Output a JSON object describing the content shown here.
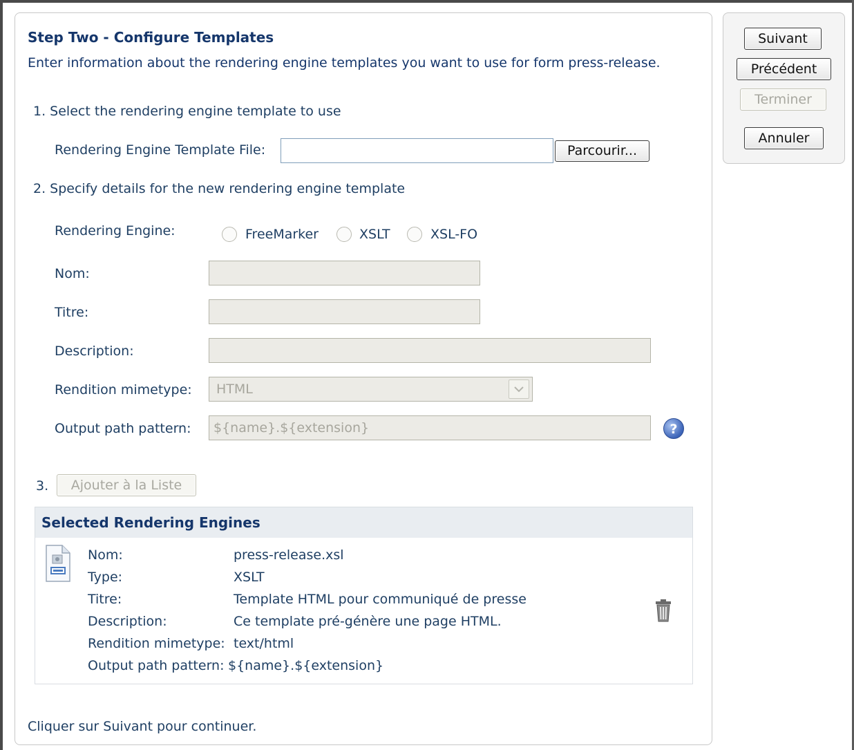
{
  "wizard": {
    "title": "Step Two - Configure Templates",
    "intro": "Enter information about the rendering engine templates you want to use for form press-release.",
    "footer": "Cliquer sur Suivant pour continuer."
  },
  "nav_buttons": {
    "next": "Suivant",
    "previous": "Précédent",
    "finish": "Terminer",
    "cancel": "Annuler"
  },
  "step1": {
    "heading": "1. Select the rendering engine template to use",
    "file_label": "Rendering Engine Template File:",
    "file_value": "",
    "browse_button": "Parcourir..."
  },
  "step2": {
    "heading": "2. Specify details for the new rendering engine template",
    "engine_label": "Rendering Engine:",
    "engines": [
      "FreeMarker",
      "XSLT",
      "XSL-FO"
    ],
    "name_label": "Nom:",
    "name_value": "",
    "title_label": "Titre:",
    "title_value": "",
    "description_label": "Description:",
    "description_value": "",
    "mimetype_label": "Rendition mimetype:",
    "mimetype_value": "HTML",
    "output_label": "Output path pattern:",
    "output_value": "${name}.${extension}",
    "help_icon": "?"
  },
  "step3": {
    "number": "3.",
    "add_button": "Ajouter à la Liste"
  },
  "selected": {
    "heading": "Selected Rendering Engines",
    "file_icon": "document-icon",
    "rows": [
      {
        "key": "Nom:",
        "value": "press-release.xsl"
      },
      {
        "key": "Type:",
        "value": "XSLT"
      },
      {
        "key": "Titre:",
        "value": "Template HTML pour communiqué de presse"
      },
      {
        "key": "Description:",
        "value": "Ce template pré-génère une page HTML."
      },
      {
        "key": "Rendition mimetype:",
        "value": "text/html"
      },
      {
        "key": "Output path pattern:",
        "value": "${name}.${extension}"
      }
    ]
  }
}
